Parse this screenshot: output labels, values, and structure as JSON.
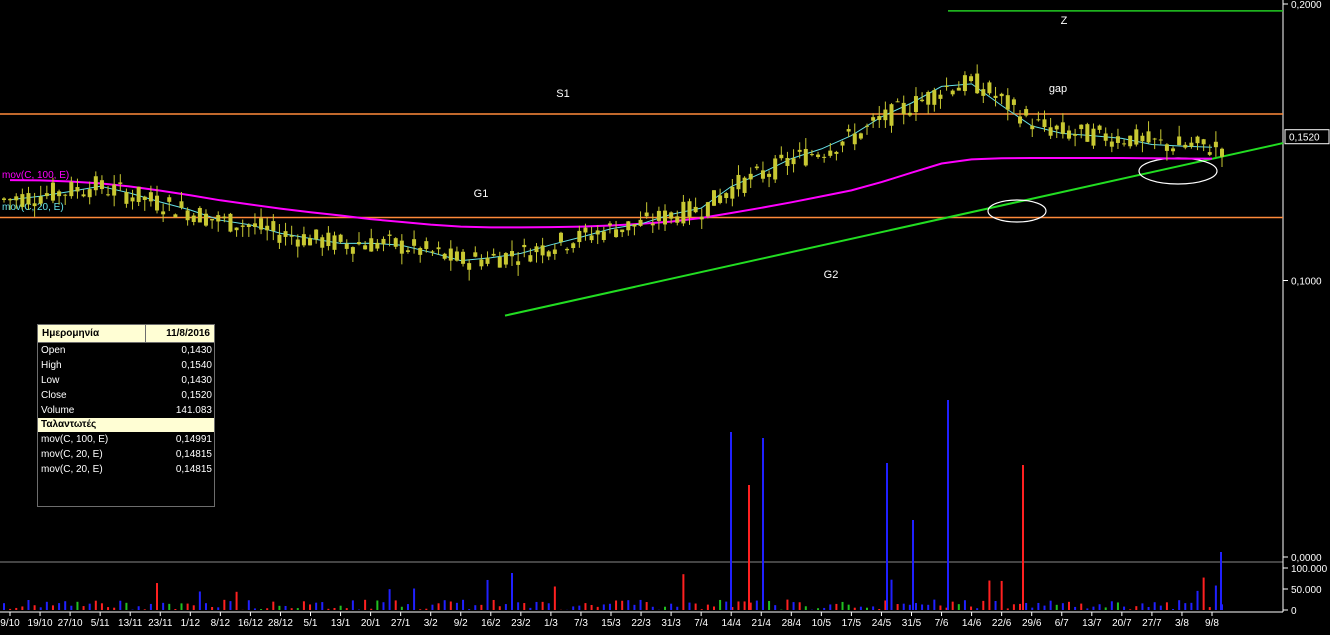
{
  "chart_data": {
    "type": "candlestick",
    "price_axis": {
      "ticks": [
        {
          "value": 0.2,
          "label": "0,2000"
        },
        {
          "value": 0.1,
          "label": "0,1000"
        },
        {
          "value": 0.0,
          "label": "0,0000"
        }
      ],
      "last_price_label": "0,1520",
      "last_price": 0.152
    },
    "volume_axis": {
      "ticks": [
        {
          "value": 100000,
          "label": "100.000"
        },
        {
          "value": 50000,
          "label": "50.000"
        },
        {
          "value": 0,
          "label": "0"
        }
      ]
    },
    "x_labels": [
      "9/10",
      "19/10",
      "27/10",
      "5/11",
      "13/11",
      "23/11",
      "1/12",
      "8/12",
      "16/12",
      "28/12",
      "5/1",
      "13/1",
      "20/1",
      "27/1",
      "3/2",
      "9/2",
      "16/2",
      "23/2",
      "1/3",
      "7/3",
      "15/3",
      "22/3",
      "31/3",
      "7/4",
      "14/4",
      "21/4",
      "28/4",
      "10/5",
      "17/5",
      "24/5",
      "31/5",
      "7/6",
      "14/6",
      "22/6",
      "29/6",
      "6/7",
      "13/7",
      "20/7",
      "27/7",
      "3/8",
      "9/8"
    ],
    "series": [
      {
        "name": "mov(C, 100, E)",
        "color": "#ff00ff",
        "legend_label": "mov(C, 100, E)",
        "values": [
          0.1363,
          0.1362,
          0.1358,
          0.1351,
          0.134,
          0.1325,
          0.1308,
          0.129,
          0.1275,
          0.126,
          0.1247,
          0.1235,
          0.1222,
          0.1212,
          0.1202,
          0.1195,
          0.1192,
          0.1192,
          0.1193,
          0.1195,
          0.1199,
          0.1205,
          0.1213,
          0.1226,
          0.1244,
          0.1263,
          0.1283,
          0.1304,
          0.1326,
          0.1356,
          0.139,
          0.1423,
          0.1438,
          0.1442,
          0.1443,
          0.1443,
          0.1443,
          0.1443,
          0.1442,
          0.1441,
          0.1441
        ]
      },
      {
        "name": "mov(C, 20, E)",
        "color": "#66e0e6",
        "legend_label": "mov(C, 20, E)",
        "values": [
          0.1292,
          0.1305,
          0.1322,
          0.1341,
          0.1316,
          0.1284,
          0.1255,
          0.1218,
          0.1201,
          0.1171,
          0.1152,
          0.1134,
          0.1135,
          0.1128,
          0.1102,
          0.1072,
          0.1082,
          0.1098,
          0.1129,
          0.1157,
          0.1187,
          0.1205,
          0.1239,
          0.1262,
          0.134,
          0.1388,
          0.1441,
          0.1476,
          0.1524,
          0.1592,
          0.1642,
          0.1702,
          0.1711,
          0.1633,
          0.1559,
          0.1532,
          0.1524,
          0.1514,
          0.1492,
          0.1486,
          0.1482
        ]
      }
    ],
    "annotations": [
      {
        "label": "S1",
        "kind": "horizontal",
        "value": 0.1602,
        "color": "#ff8a3a"
      },
      {
        "label": "G1",
        "kind": "horizontal",
        "value": 0.1228,
        "color": "#ff8a3a"
      },
      {
        "label": "Z",
        "kind": "horizontal",
        "value": 0.1975,
        "color": "#22cc22"
      },
      {
        "label": "G2",
        "kind": "trendline",
        "from": [
          0.0873,
          0.0873
        ],
        "color": "#22dd22"
      },
      {
        "label": "gap"
      }
    ],
    "grid": false
  },
  "info_panel": {
    "header_label": "Ημερομηνία",
    "date": "11/8/2016",
    "rows": [
      {
        "label": "Open",
        "value": "0,1430"
      },
      {
        "label": "High",
        "value": "0,1540"
      },
      {
        "label": "Low",
        "value": "0,1430"
      },
      {
        "label": "Close",
        "value": "0,1520"
      },
      {
        "label": "Volume",
        "value": "141.083"
      }
    ],
    "indicators_title": "Ταλαντωτές",
    "indicators": [
      {
        "label": "mov(C, 100, E)",
        "value": "0,14991"
      },
      {
        "label": "mov(C, 20, E)",
        "value": "0,14815"
      },
      {
        "label": "mov(C, 20, E)",
        "value": "0,14815"
      }
    ]
  },
  "colors": {
    "background": "#000000",
    "candle": "#c8c832",
    "volume_up": "#ff2020",
    "volume_down": "#2020ff",
    "volume_neutral": "#20c020",
    "axis": "#ffffff"
  }
}
